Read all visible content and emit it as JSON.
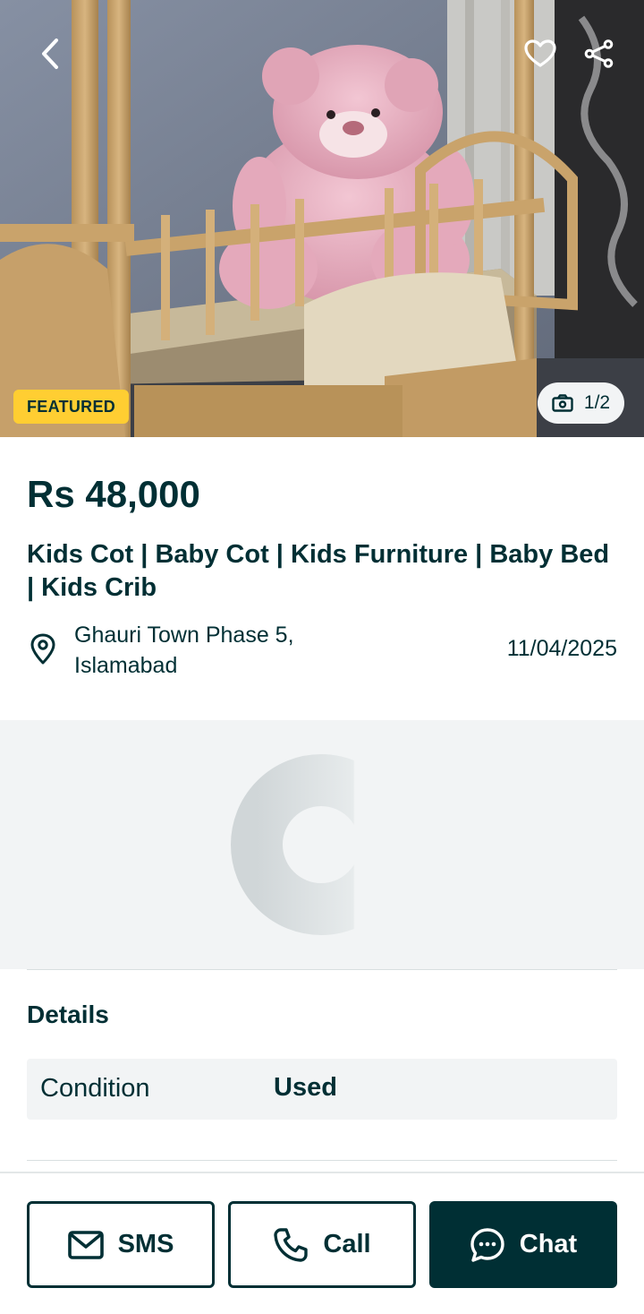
{
  "listing": {
    "featured_badge": "FEATURED",
    "image_counter": "1/2",
    "price": "Rs 48,000",
    "title": "Kids Cot | Baby Cot | Kids Furniture | Baby Bed | Kids Crib",
    "location": "Ghauri Town Phase 5, Islamabad",
    "date": "11/04/2025"
  },
  "details": {
    "heading": "Details",
    "rows": [
      {
        "key": "Condition",
        "value": "Used"
      }
    ]
  },
  "actions": {
    "sms_label": "SMS",
    "call_label": "Call",
    "chat_label": "Chat"
  },
  "icons": {
    "back": "chevron-left-icon",
    "favorite": "heart-icon",
    "share": "share-icon",
    "camera": "camera-icon",
    "location": "location-pin-icon",
    "sms": "envelope-icon",
    "call": "phone-icon",
    "chat": "chat-bubble-icon"
  },
  "colors": {
    "primary": "#002f34",
    "featured": "#ffce32",
    "surface": "#f2f4f5"
  }
}
